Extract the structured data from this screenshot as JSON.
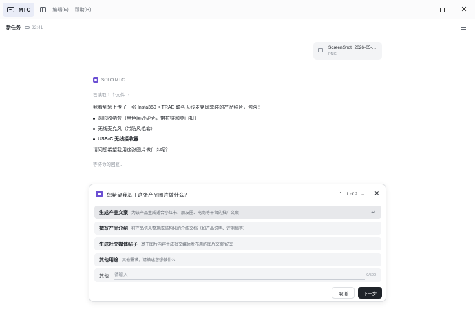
{
  "titlebar": {
    "app_name": "MTC",
    "menus": [
      "编辑(E)",
      "帮助(H)"
    ]
  },
  "task": {
    "title": "新任务",
    "time": "22:41"
  },
  "attachment": {
    "name": "ScreenShot_2026-05-...",
    "type": "PNG"
  },
  "agent": {
    "name": "SOLO MTC",
    "read_files": "已读取 1 个文件",
    "intro": "我看到您上传了一张 Insta360 × TRAE 联名无线麦克风套装的产品照片，包含：",
    "bullets": [
      "圆形收纳盒（黑色磨砂硬壳，带拉链和登山扣）",
      "无线麦克风（带防风毛套）",
      "USB-C 无线接收器"
    ],
    "question": "请问您希望我用这张图片做什么呢？",
    "waiting": "等待你的回复..."
  },
  "panel": {
    "question": "您希望我基于这张产品图片做什么？",
    "pager": "1 of 2",
    "options": [
      {
        "title": "生成产品文案",
        "desc": "为该产品生成适合小红书、朋友圈、电商等平台的推广文案"
      },
      {
        "title": "撰写产品介绍",
        "desc": "将产品信息整理成结构化的介绍文档（如产品说明、评测稿等）"
      },
      {
        "title": "生成社交媒体帖子",
        "desc": "基于图片内容生成社交媒体发布用的图片文案/配文"
      },
      {
        "title": "其他用途",
        "desc": "其他需求，请描述您想做什么"
      }
    ],
    "other_label": "其他",
    "other_placeholder": "请输入",
    "counter": "0/500",
    "cancel_label": "取消",
    "next_label": "下一步"
  },
  "icons": {
    "app": "mtc-logo-icon",
    "sidebar": "sidebar-toggle-icon",
    "cloud": "cloud-icon",
    "image": "image-icon",
    "enter": "enter-icon"
  },
  "colors": {
    "accent": "#6b4fd3",
    "primary_button": "#1f2329"
  }
}
